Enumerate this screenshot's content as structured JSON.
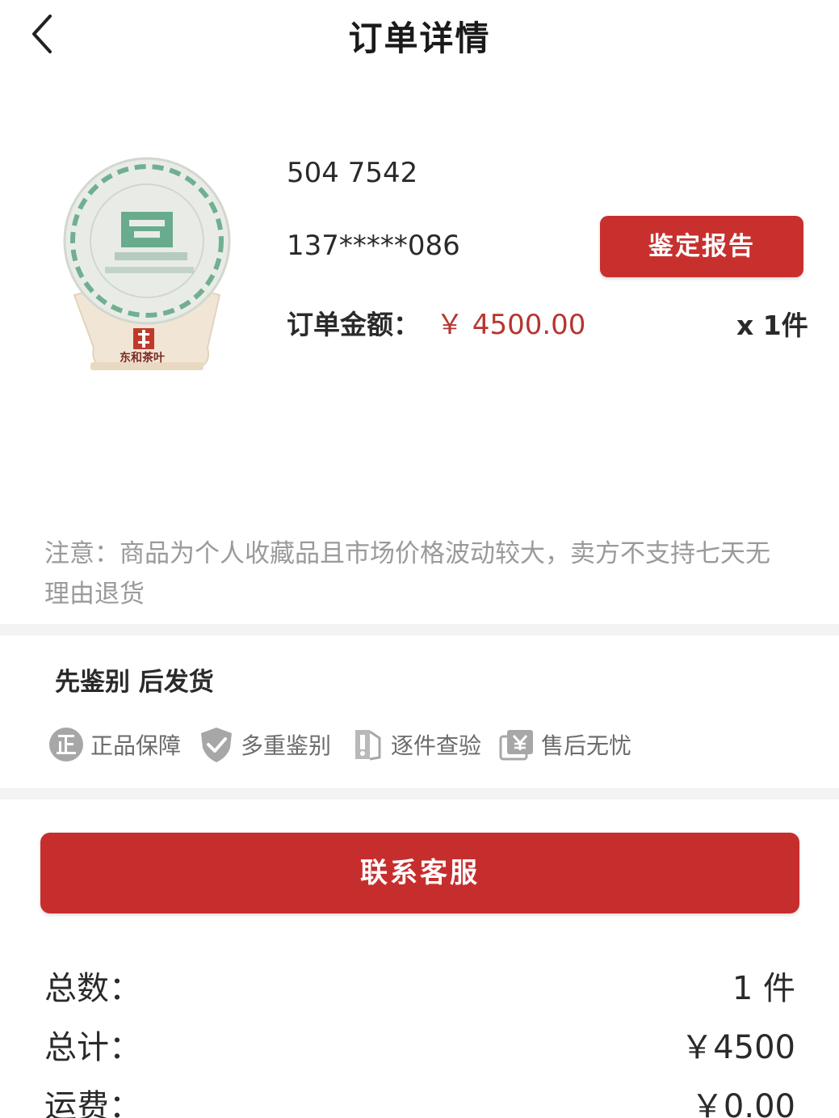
{
  "header": {
    "title": "订单详情"
  },
  "product": {
    "code": "504 7542",
    "seller_phone": "137*****086",
    "report_button_label": "鉴定报告",
    "amount_label": "订单金额：",
    "amount_value": "￥ 4500.00",
    "quantity": "x 1件",
    "image_brand_text": "东和茶叶"
  },
  "notice": {
    "text": "注意：商品为个人收藏品且市场价格波动较大，卖方不支持七天无理由退货"
  },
  "guarantee": {
    "title": "先鉴别 后发货",
    "features": [
      {
        "icon": "genuine-badge-icon",
        "label": "正品保障"
      },
      {
        "icon": "shield-check-icon",
        "label": "多重鉴别"
      },
      {
        "icon": "inspect-icon",
        "label": "逐件查验"
      },
      {
        "icon": "yuan-card-icon",
        "label": "售后无忧"
      }
    ]
  },
  "contact_button_label": "联系客服",
  "summary": {
    "total_count_label": "总数：",
    "total_count_value": "1 件",
    "subtotal_label": "总计：",
    "subtotal_value": "￥4500",
    "shipping_label": "运费：",
    "shipping_value": "￥0.00"
  },
  "colors": {
    "accent_red": "#c62e2d",
    "price_red": "#b7352f",
    "muted_text": "#9a9a9a"
  }
}
